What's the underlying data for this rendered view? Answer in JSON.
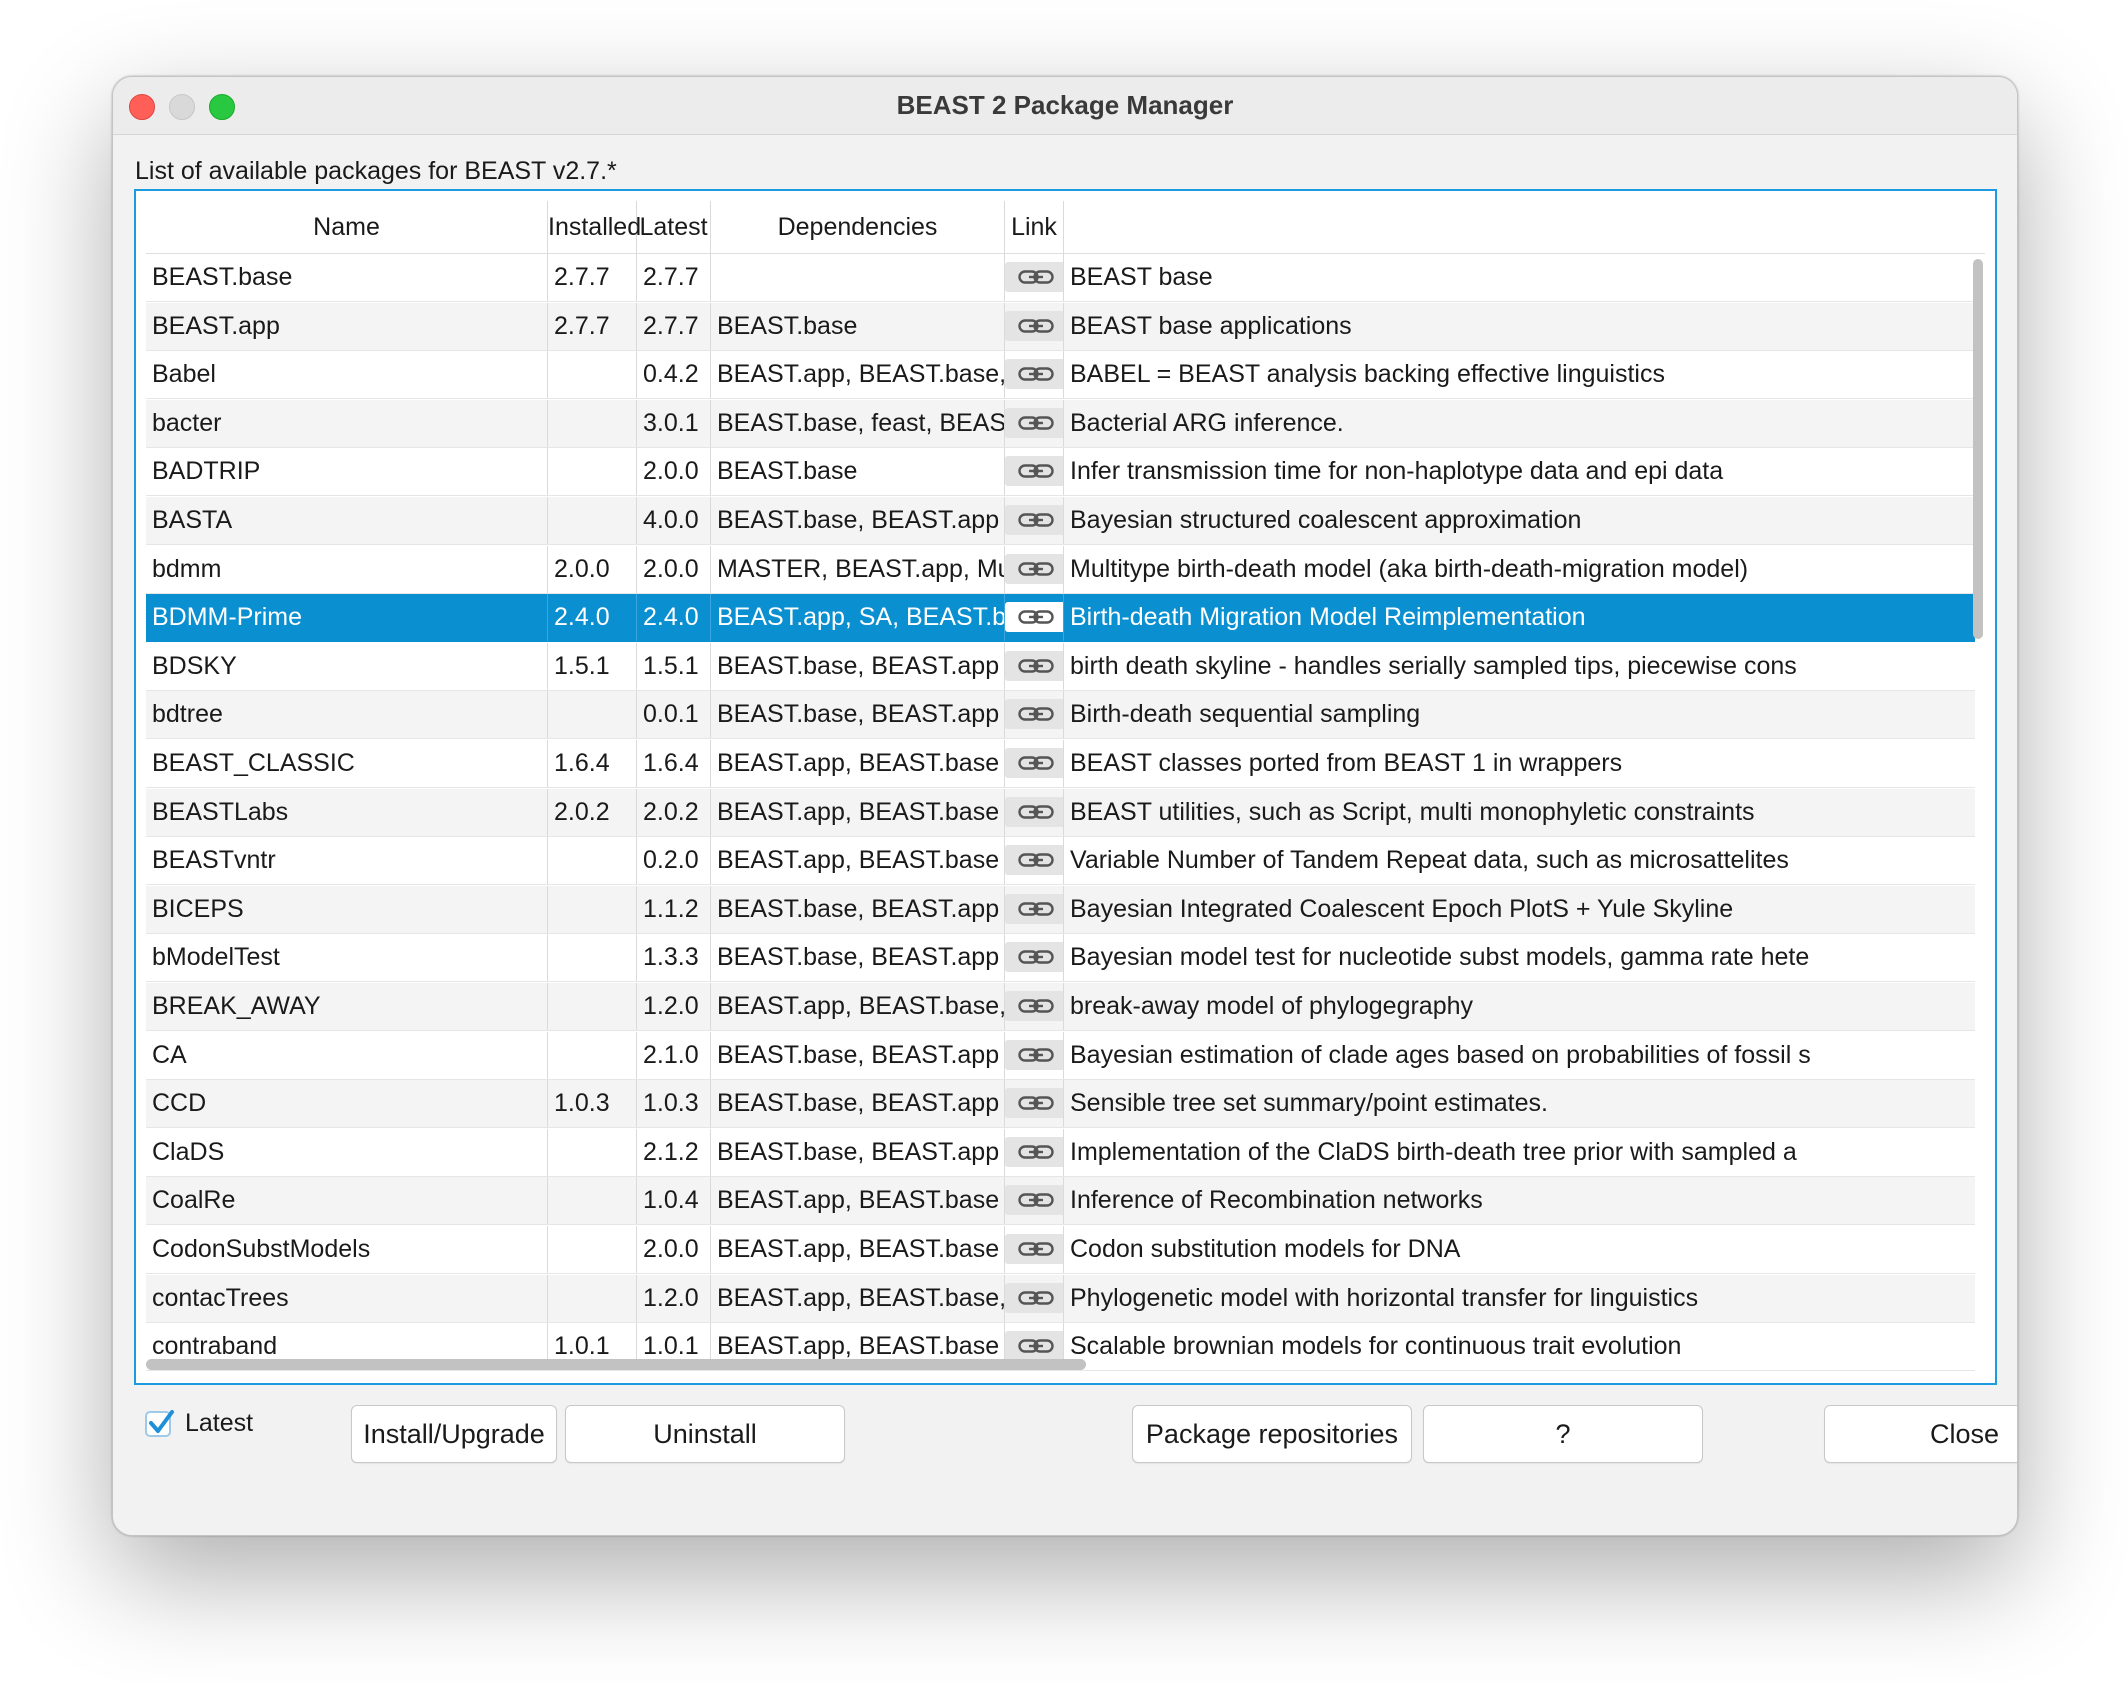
{
  "window": {
    "title": "BEAST 2 Package Manager"
  },
  "list_label": "List of available packages for BEAST v2.7.*",
  "table": {
    "columns": [
      "Name",
      "Installed",
      "Latest",
      "Dependencies",
      "Link",
      ""
    ],
    "link_icon": "link-icon",
    "selected_index": 7,
    "rows": [
      {
        "name": "BEAST.base",
        "installed": "2.7.7",
        "latest": "2.7.7",
        "deps": "",
        "desc": "BEAST base"
      },
      {
        "name": "BEAST.app",
        "installed": "2.7.7",
        "latest": "2.7.7",
        "deps": "BEAST.base",
        "desc": "BEAST base applications"
      },
      {
        "name": "Babel",
        "installed": "",
        "latest": "0.4.2",
        "deps": "BEAST.app, BEAST.base, BEAST…",
        "desc": "BABEL = BEAST analysis backing effective linguistics"
      },
      {
        "name": "bacter",
        "installed": "",
        "latest": "3.0.1",
        "deps": "BEAST.base, feast, BEAST.app",
        "desc": "Bacterial ARG inference."
      },
      {
        "name": "BADTRIP",
        "installed": "",
        "latest": "2.0.0",
        "deps": "BEAST.base",
        "desc": "Infer transmission time for non-haplotype data and epi data"
      },
      {
        "name": "BASTA",
        "installed": "",
        "latest": "4.0.0",
        "deps": "BEAST.base, BEAST.app",
        "desc": "Bayesian structured coalescent approximation"
      },
      {
        "name": "bdmm",
        "installed": "2.0.0",
        "latest": "2.0.0",
        "deps": "MASTER, BEAST.app, MultiType…",
        "desc": "Multitype birth-death model (aka birth-death-migration model)"
      },
      {
        "name": "BDMM-Prime",
        "installed": "2.4.0",
        "latest": "2.4.0",
        "deps": "BEAST.app, SA, BEAST.base",
        "desc": "Birth-death Migration Model Reimplementation"
      },
      {
        "name": "BDSKY",
        "installed": "1.5.1",
        "latest": "1.5.1",
        "deps": "BEAST.base, BEAST.app",
        "desc": "birth death skyline - handles serially sampled tips, piecewise cons"
      },
      {
        "name": "bdtree",
        "installed": "",
        "latest": "0.0.1",
        "deps": "BEAST.base, BEAST.app",
        "desc": "Birth-death sequential sampling"
      },
      {
        "name": "BEAST_CLASSIC",
        "installed": "1.6.4",
        "latest": "1.6.4",
        "deps": "BEAST.app, BEAST.base",
        "desc": "BEAST classes ported from BEAST 1 in wrappers"
      },
      {
        "name": "BEASTLabs",
        "installed": "2.0.2",
        "latest": "2.0.2",
        "deps": "BEAST.app, BEAST.base",
        "desc": "BEAST utilities, such as Script, multi monophyletic constraints"
      },
      {
        "name": "BEASTvntr",
        "installed": "",
        "latest": "0.2.0",
        "deps": "BEAST.app, BEAST.base",
        "desc": "Variable Number of Tandem Repeat data, such as microsattelites"
      },
      {
        "name": "BICEPS",
        "installed": "",
        "latest": "1.1.2",
        "deps": "BEAST.base, BEAST.app",
        "desc": "Bayesian Integrated Coalescent Epoch PlotS + Yule Skyline"
      },
      {
        "name": "bModelTest",
        "installed": "",
        "latest": "1.3.3",
        "deps": "BEAST.base, BEAST.app",
        "desc": "Bayesian model test for nucleotide subst models, gamma rate hete"
      },
      {
        "name": "BREAK_AWAY",
        "installed": "",
        "latest": "1.2.0",
        "deps": "BEAST.app, BEAST.base, BEAST…",
        "desc": "break-away model of phylogegraphy"
      },
      {
        "name": "CA",
        "installed": "",
        "latest": "2.1.0",
        "deps": "BEAST.base, BEAST.app",
        "desc": "Bayesian estimation of clade ages based on probabilities of fossil s"
      },
      {
        "name": "CCD",
        "installed": "1.0.3",
        "latest": "1.0.3",
        "deps": "BEAST.base, BEAST.app",
        "desc": "Sensible tree set summary/point estimates."
      },
      {
        "name": "ClaDS",
        "installed": "",
        "latest": "2.1.2",
        "deps": "BEAST.base, BEAST.app",
        "desc": "Implementation of the ClaDS birth-death tree prior with sampled a"
      },
      {
        "name": "CoalRe",
        "installed": "",
        "latest": "1.0.4",
        "deps": "BEAST.app, BEAST.base",
        "desc": "Inference of Recombination networks"
      },
      {
        "name": "CodonSubstModels",
        "installed": "",
        "latest": "2.0.0",
        "deps": "BEAST.app, BEAST.base",
        "desc": "Codon substitution models for DNA"
      },
      {
        "name": "contacTrees",
        "installed": "",
        "latest": "1.2.0",
        "deps": "BEAST.app, BEAST.base, feast, B…",
        "desc": "Phylogenetic model with horizontal transfer for linguistics"
      },
      {
        "name": "contraband",
        "installed": "1.0.1",
        "latest": "1.0.1",
        "deps": "BEAST.app, BEAST.base",
        "desc": "Scalable brownian models for continuous trait evolution"
      }
    ]
  },
  "footer": {
    "latest_checkbox": {
      "label": "Latest",
      "checked": true
    },
    "buttons": {
      "install": "Install/Upgrade",
      "uninstall": "Uninstall",
      "repos": "Package repositories",
      "help": "?",
      "close": "Close"
    }
  },
  "colors": {
    "accent": "#0a8fd0",
    "frame": "#1e9be0"
  }
}
